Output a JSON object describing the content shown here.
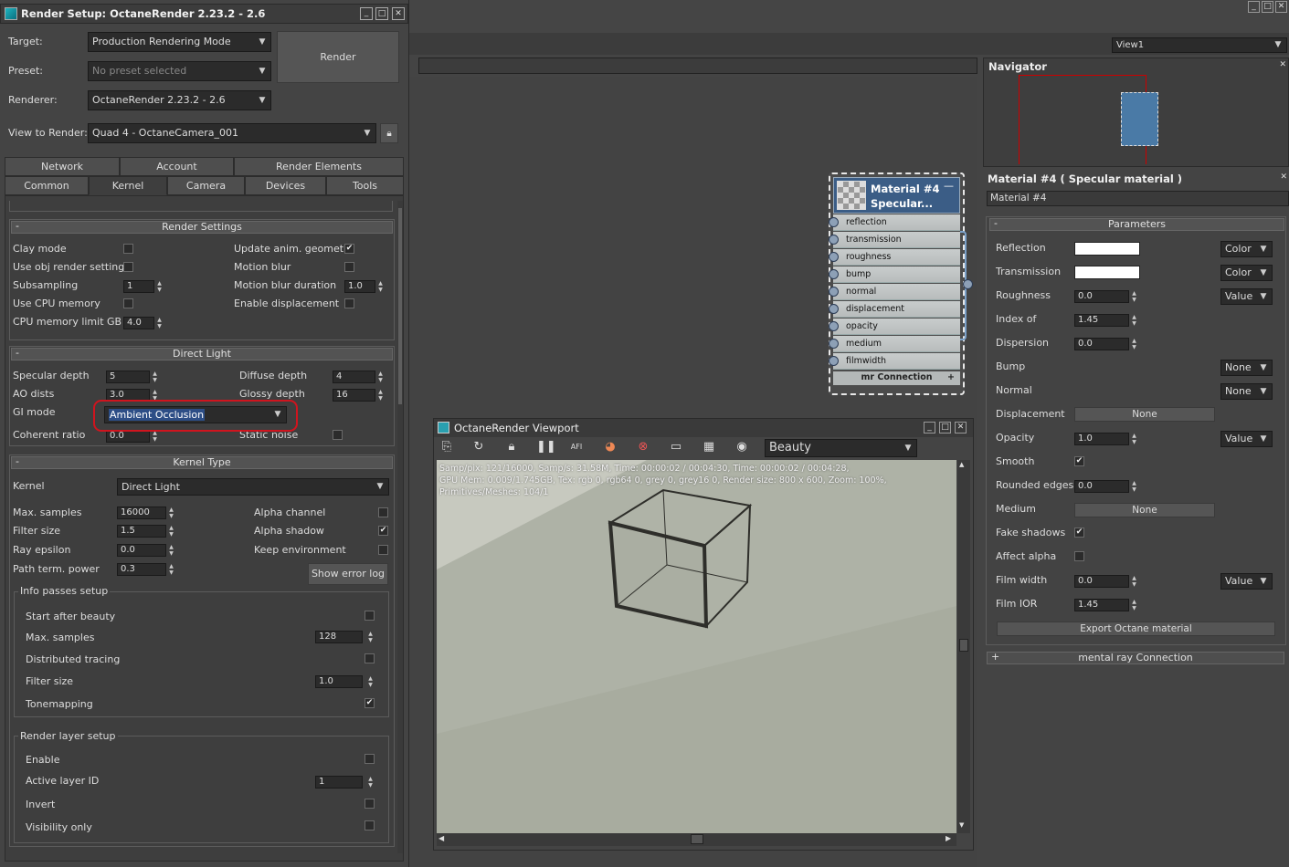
{
  "render_setup": {
    "title": "Render Setup: OctaneRender 2.23.2 - 2.6",
    "target_label": "Target:",
    "target_value": "Production Rendering Mode",
    "preset_label": "Preset:",
    "preset_value": "No preset selected",
    "renderer_label": "Renderer:",
    "renderer_value": "OctaneRender 2.23.2 - 2.6",
    "view_label": "View to Render:",
    "view_value": "Quad 4 - OctaneCamera_001",
    "render_button": "Render",
    "tabs_row1": [
      "Network",
      "Account",
      "Render Elements"
    ],
    "tabs_row2": [
      "Common",
      "Kernel",
      "Camera",
      "Devices",
      "Tools"
    ],
    "render_settings": {
      "header": "Render Settings",
      "clay_mode": "Clay mode",
      "use_obj": "Use obj render settings",
      "subsampling": "Subsampling",
      "subsampling_value": "1",
      "use_cpu": "Use CPU memory",
      "cpu_limit": "CPU memory limit GB",
      "cpu_limit_value": "4.0",
      "update_anim": "Update anim. geometry",
      "motion_blur": "Motion blur",
      "motion_blur_duration": "Motion blur duration",
      "motion_blur_duration_value": "1.0",
      "enable_displacement": "Enable displacement",
      "check_mark": "✔"
    },
    "direct_light": {
      "header": "Direct Light",
      "specular_depth": "Specular depth",
      "specular_depth_value": "5",
      "ao_dists": "AO dists",
      "ao_dists_value": "3.0",
      "gi_mode": "GI mode",
      "gi_mode_value": "Ambient Occlusion",
      "coherent_ratio": "Coherent ratio",
      "coherent_ratio_value": "0.0",
      "diffuse_depth": "Diffuse depth",
      "diffuse_depth_value": "4",
      "glossy_depth": "Glossy depth",
      "glossy_depth_value": "16",
      "static_noise": "Static noise"
    },
    "kernel_type": {
      "header": "Kernel Type",
      "kernel_label": "Kernel",
      "kernel_value": "Direct Light",
      "max_samples": "Max. samples",
      "max_samples_value": "16000",
      "filter_size": "Filter size",
      "filter_size_value": "1.5",
      "ray_epsilon": "Ray epsilon",
      "ray_epsilon_value": "0.0",
      "path_term": "Path term. power",
      "path_term_value": "0.3",
      "alpha_channel": "Alpha channel",
      "alpha_shadow": "Alpha shadow",
      "keep_env": "Keep environment",
      "show_error_log": "Show error log"
    },
    "info_passes": {
      "header": "Info passes setup",
      "start_after_beauty": "Start after beauty",
      "max_samples": "Max. samples",
      "max_samples_value": "128",
      "distributed_tracing": "Distributed tracing",
      "filter_size": "Filter size",
      "filter_size_value": "1.0",
      "tonemapping": "Tonemapping"
    },
    "render_layer": {
      "header": "Render layer setup",
      "enable": "Enable",
      "active_layer_id": "Active layer ID",
      "active_layer_id_value": "1",
      "invert": "Invert",
      "visibility_only": "Visibility only"
    }
  },
  "view_selector": "View1",
  "node": {
    "title_line1": "Material #4",
    "title_line2": "Specular...",
    "ports": [
      "reflection",
      "transmission",
      "roughness",
      "bump",
      "normal",
      "displacement",
      "opacity",
      "medium",
      "filmwidth"
    ],
    "footer": "mr Connection",
    "footer_plus": "+"
  },
  "viewport": {
    "title": "OctaneRender Viewport",
    "pass_value": "Beauty",
    "stats_line1": "Samp/pix: 121/16000,   Samp/s: 31.58M,   Time: 00:00:02 / 00:04:30,   Time: 00:00:02 / 00:04:28,",
    "stats_line2": "GPU Mem: 0.009/1.745GB,   Tex: rgb 0, rgb64 0, grey 0, grey16 0,   Render size: 800 x 600,   Zoom: 100%,",
    "stats_line3": "Primitives/Meshes: 104/1",
    "ai_icon": "AFI"
  },
  "navigator": {
    "title": "Navigator"
  },
  "material_panel": {
    "title": "Material #4  ( Specular material )",
    "name_value": "Material #4",
    "params_header": "Parameters",
    "reflection": "Reflection",
    "transmission": "Transmission",
    "roughness": "Roughness",
    "roughness_value": "0.0",
    "index_of": "Index of",
    "index_of_value": "1.45",
    "dispersion": "Dispersion",
    "dispersion_value": "0.0",
    "bump": "Bump",
    "normal": "Normal",
    "displacement": "Displacement",
    "displacement_value": "None",
    "opacity": "Opacity",
    "opacity_value": "1.0",
    "smooth": "Smooth",
    "rounded_edges": "Rounded edges",
    "rounded_edges_value": "0.0",
    "medium": "Medium",
    "medium_value": "None",
    "fake_shadows": "Fake shadows",
    "affect_alpha": "Affect alpha",
    "film_width": "Film width",
    "film_width_value": "0.0",
    "film_ior": "Film IOR",
    "film_ior_value": "1.45",
    "export_button": "Export Octane material",
    "mr_connection": "mental ray Connection",
    "mr_plus": "+",
    "type_color": "Color",
    "type_value": "Value",
    "type_none": "None"
  },
  "colors": {
    "bg": "#444444",
    "panel": "#3e3e3e",
    "highlight_red": "#d0141e",
    "node_header": "#3b5d86",
    "nav_box": "#4a7aa6"
  }
}
